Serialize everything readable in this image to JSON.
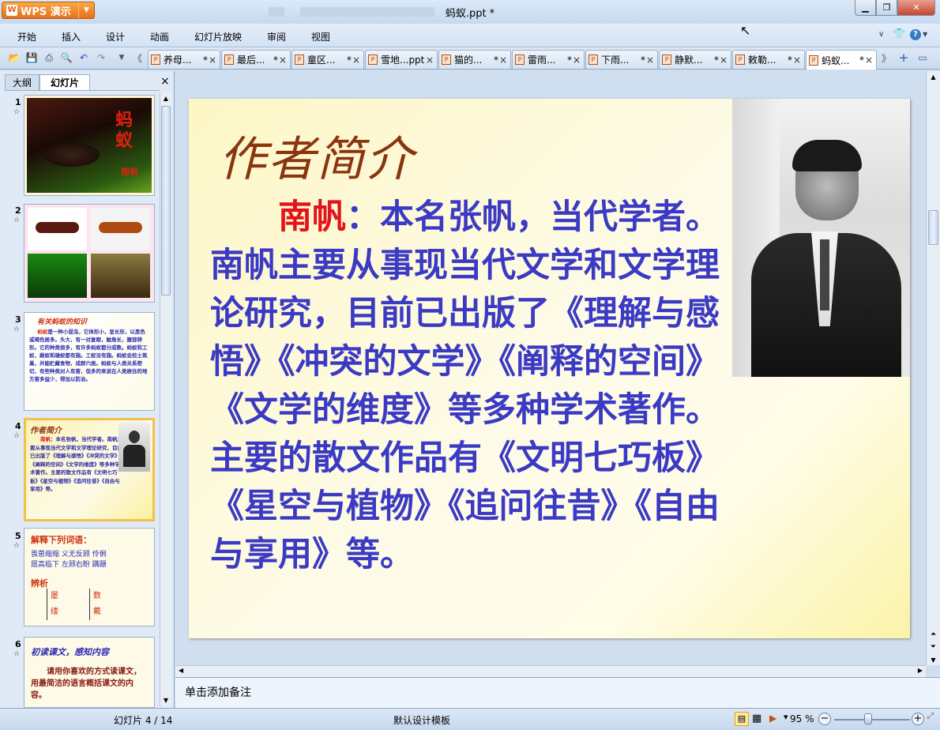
{
  "app": {
    "button_label": "WPS 演示",
    "window_title": "蚂蚁.ppt *"
  },
  "menu": [
    "开始",
    "插入",
    "设计",
    "动画",
    "幻灯片放映",
    "审阅",
    "视图"
  ],
  "doc_tabs": [
    {
      "label": "养母...",
      "mark": "*"
    },
    {
      "label": "最后...",
      "mark": "*"
    },
    {
      "label": "童区...",
      "mark": "*"
    },
    {
      "label": "雪地...ppt",
      "mark": ""
    },
    {
      "label": "猫的...",
      "mark": "*"
    },
    {
      "label": "雷雨...",
      "mark": "*"
    },
    {
      "label": "下雨...",
      "mark": "*"
    },
    {
      "label": "静默...",
      "mark": "*"
    },
    {
      "label": "敕勒...",
      "mark": "*"
    },
    {
      "label": "蚂蚁...",
      "mark": "*",
      "active": true
    }
  ],
  "panel": {
    "tab_outline": "大纲",
    "tab_slides": "幻灯片",
    "close": "×"
  },
  "thumbs": {
    "s1_title_chars": [
      "蚂",
      "蚁"
    ],
    "s1_author": "南帆",
    "s3_title": "有关蚂蚁的知识",
    "s3_lead": "蚂蚁",
    "s3_text": "是一种小昆虫，它体形小，呈长形，以黑色或褐色居多。头大，有一对复眼，触角长，腹部卵形。它的种类很多，有许多蚂蚁都分成数。蚂蚁和工蚁，雌蚁和雄蚁都有翅。工蚁没有翅。蚂蚁会挖土筑巢，并能贮藏食物，成群穴居。蚂蚁与人类关系密切，有些种类对人有害，但多的来说在人类居住的地方害多益少，得加以防治。",
    "s4_title": "作者简介",
    "s4_lead": "南帆",
    "s4_text": "：本名张帆，当代学者。南帆主要从事现当代文学和文学理论研究，目前已出版了《理解与感悟》《冲突的文学》《阐释的空间》《文学的维度》等多种学术著作。主要的散文作品有《文明七巧板》《星空与植物》《追问往昔》《自由与享用》等。",
    "s5_heading": "解释下列词语：",
    "s5_line1": "畏葸缩缩  义无反顾  伶俐",
    "s5_line2": "居高临下  左顾右盼  蹒跚",
    "s5_heading2": "辨析",
    "s5_a1": "屡",
    "s5_a2": "缕",
    "s5_b1": "数",
    "s5_b2": "戴",
    "s6_title": "初读课文，感知内容",
    "s6_text": "请用你喜欢的方式读课文，用最简洁的语言概括课文的内容。"
  },
  "slide": {
    "title": "作者简介",
    "name": "南帆",
    "body": "：本名张帆，当代学者。南帆主要从事现当代文学和文学理论研究，目前已出版了《理解与感悟》《冲突的文学》《阐释的空间》《文学的维度》等多种学术著作。主要的散文作品有《文明七巧板》《星空与植物》《追问往昔》《自由与享用》等。"
  },
  "notes_placeholder": "单击添加备注",
  "status": {
    "slide_counter": "幻灯片 4 / 14",
    "template": "默认设计模板",
    "zoom": "95 %"
  },
  "colors": {
    "slide_title": "#8a3510",
    "slide_text": "#3b3ac4",
    "slide_name": "#e2131a",
    "accent_orange": "#e8701a"
  }
}
